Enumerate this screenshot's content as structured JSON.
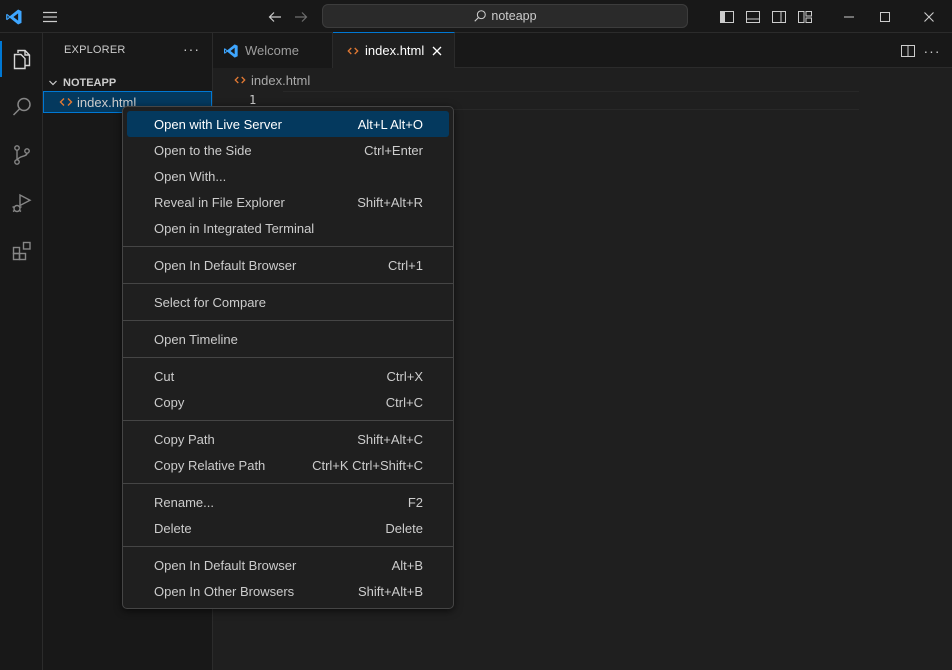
{
  "titlebar": {
    "search_text": "noteapp",
    "icons": [
      "vscode-logo-icon",
      "menu-icon",
      "back-arrow-icon",
      "forward-arrow-icon",
      "search-icon",
      "toggle-primary-sidebar-icon",
      "toggle-panel-icon",
      "toggle-secondary-sidebar-icon",
      "customize-layout-icon",
      "minimize-icon",
      "maximize-icon",
      "close-icon"
    ]
  },
  "activity_bar": {
    "items": [
      "explorer-icon",
      "search-icon",
      "source-control-icon",
      "run-debug-icon",
      "extensions-icon"
    ],
    "active": "explorer-icon"
  },
  "sidebar": {
    "title": "EXPLORER",
    "more": "···",
    "folder": "NOTEAPP",
    "file": "index.html"
  },
  "tabs": [
    {
      "label": "Welcome",
      "active": false
    },
    {
      "label": "index.html",
      "active": true
    }
  ],
  "breadcrumb": {
    "file": "index.html"
  },
  "editor": {
    "line_number": "1"
  },
  "context_menu": {
    "groups": [
      [
        {
          "label": "Open with Live Server",
          "shortcut": "Alt+L Alt+O",
          "selected": true
        },
        {
          "label": "Open to the Side",
          "shortcut": "Ctrl+Enter"
        },
        {
          "label": "Open With...",
          "shortcut": ""
        },
        {
          "label": "Reveal in File Explorer",
          "shortcut": "Shift+Alt+R"
        },
        {
          "label": "Open in Integrated Terminal",
          "shortcut": ""
        }
      ],
      [
        {
          "label": "Open In Default Browser",
          "shortcut": "Ctrl+1"
        }
      ],
      [
        {
          "label": "Select for Compare",
          "shortcut": ""
        }
      ],
      [
        {
          "label": "Open Timeline",
          "shortcut": ""
        }
      ],
      [
        {
          "label": "Cut",
          "shortcut": "Ctrl+X"
        },
        {
          "label": "Copy",
          "shortcut": "Ctrl+C"
        }
      ],
      [
        {
          "label": "Copy Path",
          "shortcut": "Shift+Alt+C"
        },
        {
          "label": "Copy Relative Path",
          "shortcut": "Ctrl+K Ctrl+Shift+C"
        }
      ],
      [
        {
          "label": "Rename...",
          "shortcut": "F2"
        },
        {
          "label": "Delete",
          "shortcut": "Delete"
        }
      ],
      [
        {
          "label": "Open In Default Browser",
          "shortcut": "Alt+B"
        },
        {
          "label": "Open In Other Browsers",
          "shortcut": "Shift+Alt+B"
        }
      ]
    ]
  },
  "colors": {
    "accent": "#0078d4",
    "selection": "#04395e",
    "html_file_icon": "#e37933",
    "vscode_logo": "#3ea6ff"
  }
}
